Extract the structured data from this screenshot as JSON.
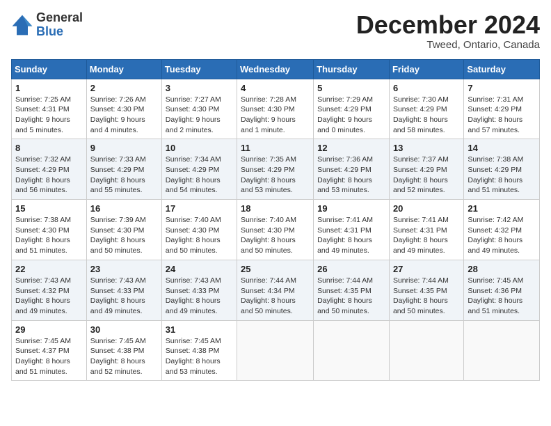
{
  "logo": {
    "general": "General",
    "blue": "Blue"
  },
  "title": "December 2024",
  "location": "Tweed, Ontario, Canada",
  "weekdays": [
    "Sunday",
    "Monday",
    "Tuesday",
    "Wednesday",
    "Thursday",
    "Friday",
    "Saturday"
  ],
  "weeks": [
    [
      {
        "day": "1",
        "info": "Sunrise: 7:25 AM\nSunset: 4:31 PM\nDaylight: 9 hours\nand 5 minutes."
      },
      {
        "day": "2",
        "info": "Sunrise: 7:26 AM\nSunset: 4:30 PM\nDaylight: 9 hours\nand 4 minutes."
      },
      {
        "day": "3",
        "info": "Sunrise: 7:27 AM\nSunset: 4:30 PM\nDaylight: 9 hours\nand 2 minutes."
      },
      {
        "day": "4",
        "info": "Sunrise: 7:28 AM\nSunset: 4:30 PM\nDaylight: 9 hours\nand 1 minute."
      },
      {
        "day": "5",
        "info": "Sunrise: 7:29 AM\nSunset: 4:29 PM\nDaylight: 9 hours\nand 0 minutes."
      },
      {
        "day": "6",
        "info": "Sunrise: 7:30 AM\nSunset: 4:29 PM\nDaylight: 8 hours\nand 58 minutes."
      },
      {
        "day": "7",
        "info": "Sunrise: 7:31 AM\nSunset: 4:29 PM\nDaylight: 8 hours\nand 57 minutes."
      }
    ],
    [
      {
        "day": "8",
        "info": "Sunrise: 7:32 AM\nSunset: 4:29 PM\nDaylight: 8 hours\nand 56 minutes."
      },
      {
        "day": "9",
        "info": "Sunrise: 7:33 AM\nSunset: 4:29 PM\nDaylight: 8 hours\nand 55 minutes."
      },
      {
        "day": "10",
        "info": "Sunrise: 7:34 AM\nSunset: 4:29 PM\nDaylight: 8 hours\nand 54 minutes."
      },
      {
        "day": "11",
        "info": "Sunrise: 7:35 AM\nSunset: 4:29 PM\nDaylight: 8 hours\nand 53 minutes."
      },
      {
        "day": "12",
        "info": "Sunrise: 7:36 AM\nSunset: 4:29 PM\nDaylight: 8 hours\nand 53 minutes."
      },
      {
        "day": "13",
        "info": "Sunrise: 7:37 AM\nSunset: 4:29 PM\nDaylight: 8 hours\nand 52 minutes."
      },
      {
        "day": "14",
        "info": "Sunrise: 7:38 AM\nSunset: 4:29 PM\nDaylight: 8 hours\nand 51 minutes."
      }
    ],
    [
      {
        "day": "15",
        "info": "Sunrise: 7:38 AM\nSunset: 4:30 PM\nDaylight: 8 hours\nand 51 minutes."
      },
      {
        "day": "16",
        "info": "Sunrise: 7:39 AM\nSunset: 4:30 PM\nDaylight: 8 hours\nand 50 minutes."
      },
      {
        "day": "17",
        "info": "Sunrise: 7:40 AM\nSunset: 4:30 PM\nDaylight: 8 hours\nand 50 minutes."
      },
      {
        "day": "18",
        "info": "Sunrise: 7:40 AM\nSunset: 4:30 PM\nDaylight: 8 hours\nand 50 minutes."
      },
      {
        "day": "19",
        "info": "Sunrise: 7:41 AM\nSunset: 4:31 PM\nDaylight: 8 hours\nand 49 minutes."
      },
      {
        "day": "20",
        "info": "Sunrise: 7:41 AM\nSunset: 4:31 PM\nDaylight: 8 hours\nand 49 minutes."
      },
      {
        "day": "21",
        "info": "Sunrise: 7:42 AM\nSunset: 4:32 PM\nDaylight: 8 hours\nand 49 minutes."
      }
    ],
    [
      {
        "day": "22",
        "info": "Sunrise: 7:43 AM\nSunset: 4:32 PM\nDaylight: 8 hours\nand 49 minutes."
      },
      {
        "day": "23",
        "info": "Sunrise: 7:43 AM\nSunset: 4:33 PM\nDaylight: 8 hours\nand 49 minutes."
      },
      {
        "day": "24",
        "info": "Sunrise: 7:43 AM\nSunset: 4:33 PM\nDaylight: 8 hours\nand 49 minutes."
      },
      {
        "day": "25",
        "info": "Sunrise: 7:44 AM\nSunset: 4:34 PM\nDaylight: 8 hours\nand 50 minutes."
      },
      {
        "day": "26",
        "info": "Sunrise: 7:44 AM\nSunset: 4:35 PM\nDaylight: 8 hours\nand 50 minutes."
      },
      {
        "day": "27",
        "info": "Sunrise: 7:44 AM\nSunset: 4:35 PM\nDaylight: 8 hours\nand 50 minutes."
      },
      {
        "day": "28",
        "info": "Sunrise: 7:45 AM\nSunset: 4:36 PM\nDaylight: 8 hours\nand 51 minutes."
      }
    ],
    [
      {
        "day": "29",
        "info": "Sunrise: 7:45 AM\nSunset: 4:37 PM\nDaylight: 8 hours\nand 51 minutes."
      },
      {
        "day": "30",
        "info": "Sunrise: 7:45 AM\nSunset: 4:38 PM\nDaylight: 8 hours\nand 52 minutes."
      },
      {
        "day": "31",
        "info": "Sunrise: 7:45 AM\nSunset: 4:38 PM\nDaylight: 8 hours\nand 53 minutes."
      },
      null,
      null,
      null,
      null
    ]
  ]
}
